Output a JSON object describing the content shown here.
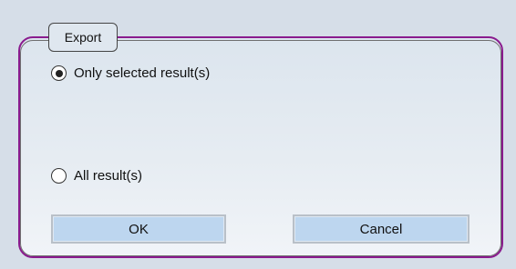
{
  "dialog": {
    "group_title": "Export",
    "options": [
      {
        "label": "Only selected result(s)",
        "selected": true
      },
      {
        "label": "All result(s)",
        "selected": false
      }
    ],
    "buttons": {
      "ok": "OK",
      "cancel": "Cancel"
    }
  }
}
